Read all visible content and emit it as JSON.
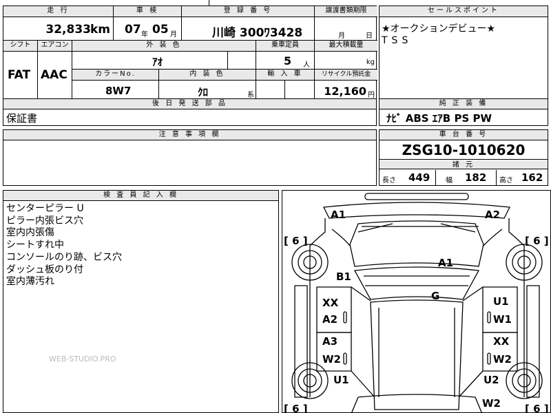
{
  "mileage": {
    "label": "走 行",
    "value": "32,833",
    "unit": "km"
  },
  "inspection": {
    "label": "車 検",
    "year": "07",
    "year_unit": "年",
    "month": "05",
    "month_unit": "月"
  },
  "registration": {
    "label": "登 録 番 号",
    "value": "川崎 300ﾜ3428"
  },
  "transfer": {
    "label": "譲渡書類期限",
    "month_unit": "月",
    "day_unit": "日"
  },
  "sales_point": {
    "label": "セールスポイント",
    "line1": "★オークションデビュー★",
    "line2": "TSS"
  },
  "shift": {
    "label": "シフト",
    "value": "FAT"
  },
  "aircon": {
    "label": "エアコン",
    "value": "AAC"
  },
  "exterior_color": {
    "label": "外 装 色",
    "value": "ｱｵ"
  },
  "capacity": {
    "label": "乗車定員",
    "value": "5",
    "unit": "人"
  },
  "max_load": {
    "label": "最大積載量",
    "unit": "kg"
  },
  "color_no": {
    "label": "カラーNo.",
    "value": "8W7"
  },
  "interior_color": {
    "label": "内 装 色",
    "value": "ｸﾛ",
    "suffix": "系"
  },
  "imported": {
    "label": "輸 入 車"
  },
  "recycle": {
    "label": "リサイクル預託金",
    "value": "12,160",
    "unit": "円"
  },
  "later_parts": {
    "label": "後 日 発 送 部 品",
    "value": "保証書"
  },
  "equipment": {
    "label": "純 正 装 備",
    "value": "ﾅﾋﾞ ABS ｴｱB PS PW"
  },
  "notes": {
    "label": "注 意 事 項 欄"
  },
  "chassis": {
    "label": "車 台 番 号",
    "value": "ZSG10-1010620"
  },
  "specs": {
    "label": "諸 元",
    "length_label": "長さ",
    "length": "449",
    "width_label": "幅",
    "width": "182",
    "height_label": "高さ",
    "height": "162"
  },
  "inspector": {
    "label": "検 査 員 記 入 欄",
    "lines": [
      "センターピラー U",
      "ピラー内張ビス穴",
      "室内内張傷",
      "シートすれ中",
      "コンソールのり跡、ビス穴",
      "ダッシュ板のり付",
      "室内薄汚れ"
    ]
  },
  "watermark": "WEB-STUDIO.PRO",
  "diagram": {
    "marks": {
      "front_left": "A1",
      "front_right": "A2",
      "tire_fl": "6",
      "tire_fr": "6",
      "tire_rl": "6",
      "tire_rr": "6",
      "hood": "A1",
      "fender_l": "B1",
      "windshield": "G",
      "door_fl_1": "XX",
      "door_fl_2": "A2",
      "door_fr_1": "U1",
      "door_fr_2": "W1",
      "door_rl_1": "A3",
      "door_rl_2": "W2",
      "door_rr_1": "XX",
      "door_rr_2": "W2",
      "quarter_l": "U1",
      "quarter_r": "U2",
      "rear_r": "W2"
    }
  }
}
